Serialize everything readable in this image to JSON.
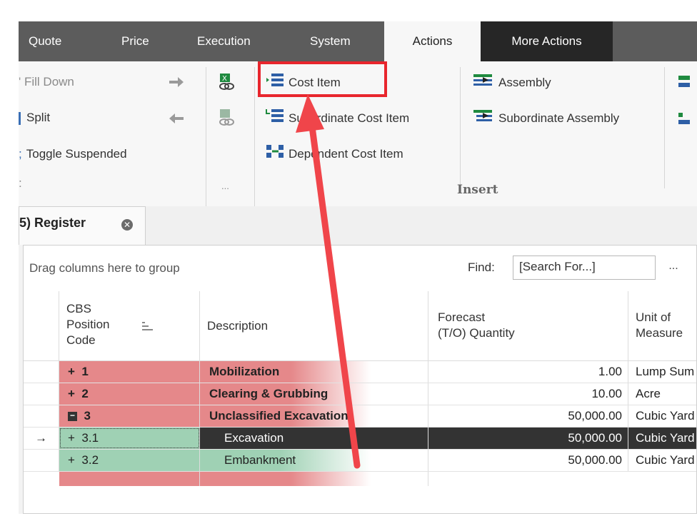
{
  "tabs": [
    {
      "label": "Quote"
    },
    {
      "label": "Price"
    },
    {
      "label": "Execution"
    },
    {
      "label": "System"
    },
    {
      "label": "Actions"
    },
    {
      "label": "More Actions"
    }
  ],
  "ribbon": {
    "fill_down": "Fill Down",
    "split": "Split",
    "toggle_suspended": "Toggle Suspended",
    "more_dots": "...",
    "cost_item": "Cost Item",
    "subordinate_cost_item": "Subordinate Cost Item",
    "dependent_cost_item": "Dependent Cost Item",
    "assembly": "Assembly",
    "subordinate_assembly": "Subordinate Assembly",
    "group_insert": "Insert"
  },
  "document_tab": {
    "label": "5) Register"
  },
  "grid": {
    "group_hint": "Drag columns here to group",
    "find_label": "Find:",
    "find_placeholder": "[Search For...]",
    "find_more": "...",
    "columns": {
      "cbs": [
        "CBS",
        "Position",
        "Code"
      ],
      "description": "Description",
      "forecast": [
        "Forecast",
        "(T/O) Quantity"
      ],
      "unit": [
        "Unit of",
        "Measure"
      ]
    },
    "rows": [
      {
        "toggle": "+",
        "code": "1",
        "description": "Mobilization",
        "quantity": "1.00",
        "unit": "Lump Sum"
      },
      {
        "toggle": "+",
        "code": "2",
        "description": "Clearing & Grubbing",
        "quantity": "10.00",
        "unit": "Acre"
      },
      {
        "toggle": "−",
        "code": "3",
        "description": "Unclassified Excavation",
        "quantity": "50,000.00",
        "unit": "Cubic Yard"
      },
      {
        "toggle": "+",
        "code": "3.1",
        "description": "Excavation",
        "quantity": "50,000.00",
        "unit": "Cubic Yard",
        "indicator": "→"
      },
      {
        "toggle": "+",
        "code": "3.2",
        "description": "Embankment",
        "quantity": "50,000.00",
        "unit": "Cubic Yard"
      }
    ]
  },
  "colors": {
    "accent_red": "#e8262d",
    "row_red": "#e5888a",
    "row_green": "#9fd1b4",
    "selected_row": "#333333"
  }
}
